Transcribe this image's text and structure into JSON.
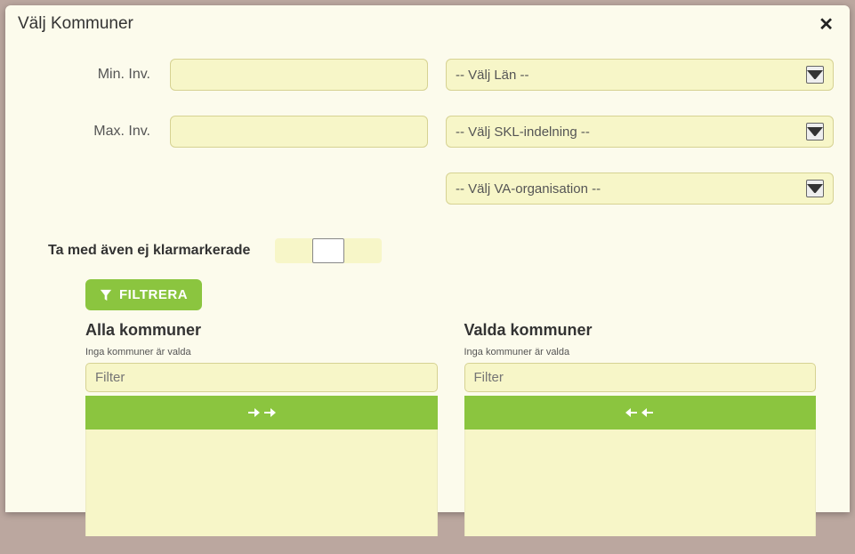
{
  "dialog": {
    "title": "Välj Kommuner"
  },
  "form": {
    "min_inv_label": "Min. Inv.",
    "min_inv_value": "",
    "max_inv_label": "Max. Inv.",
    "max_inv_value": "",
    "select_lan": "-- Välj Län --",
    "select_skl": "-- Välj SKL-indelning --",
    "select_va": "-- Välj VA-organisation --",
    "include_unmarked_label": "Ta med även ej klarmarkerade",
    "filter_button": "FILTRERA"
  },
  "lists": {
    "all": {
      "title": "Alla kommuner",
      "hint": "Inga kommuner är valda",
      "filter_placeholder": "Filter"
    },
    "selected": {
      "title": "Valda kommuner",
      "hint": "Inga kommuner är valda",
      "filter_placeholder": "Filter"
    }
  }
}
